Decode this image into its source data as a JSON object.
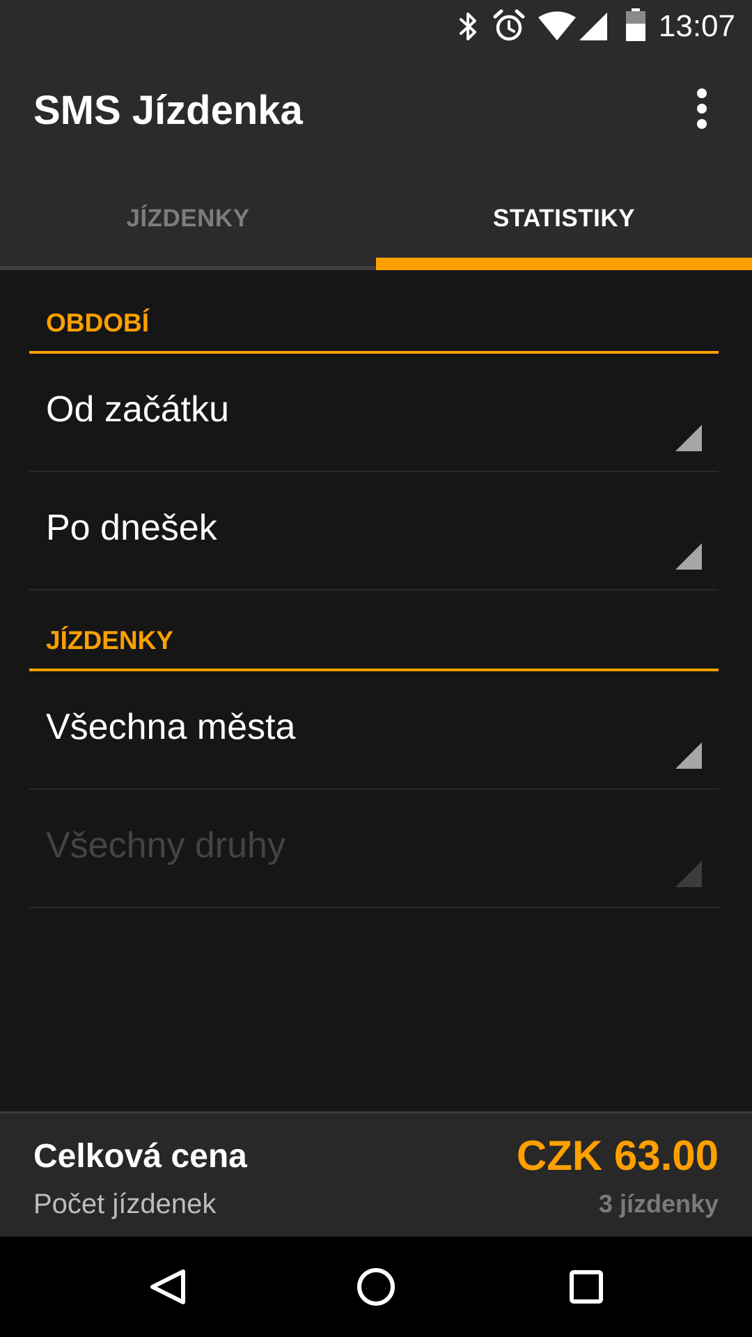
{
  "status_bar": {
    "time": "13:07",
    "icons": [
      "bluetooth-icon",
      "alarm-icon",
      "wifi-icon",
      "cell-signal-icon",
      "battery-icon"
    ]
  },
  "app_bar": {
    "title": "SMS Jízdenka",
    "overflow_icon": "more-vert-icon"
  },
  "tabs": [
    {
      "label": "JÍZDENKY",
      "selected": false
    },
    {
      "label": "STATISTIKY",
      "selected": true
    }
  ],
  "sections": {
    "period": {
      "title": "OBDOBÍ",
      "from_value": "Od začátku",
      "to_value": "Po dnešek"
    },
    "tickets": {
      "title": "JÍZDENKY",
      "city_value": "Všechna města",
      "type_value": "Všechny druhy"
    }
  },
  "summary": {
    "total_label": "Celková cena",
    "total_value": "CZK 63.00",
    "count_label": "Počet jízdenek",
    "count_value": "3 jízdenky"
  },
  "nav": {
    "back_icon": "back-triangle-icon",
    "home_icon": "home-circle-icon",
    "recents_icon": "recents-square-icon"
  },
  "colors": {
    "accent": "#ffa000",
    "app_bar": "#2b2b2b",
    "background": "#161616"
  }
}
